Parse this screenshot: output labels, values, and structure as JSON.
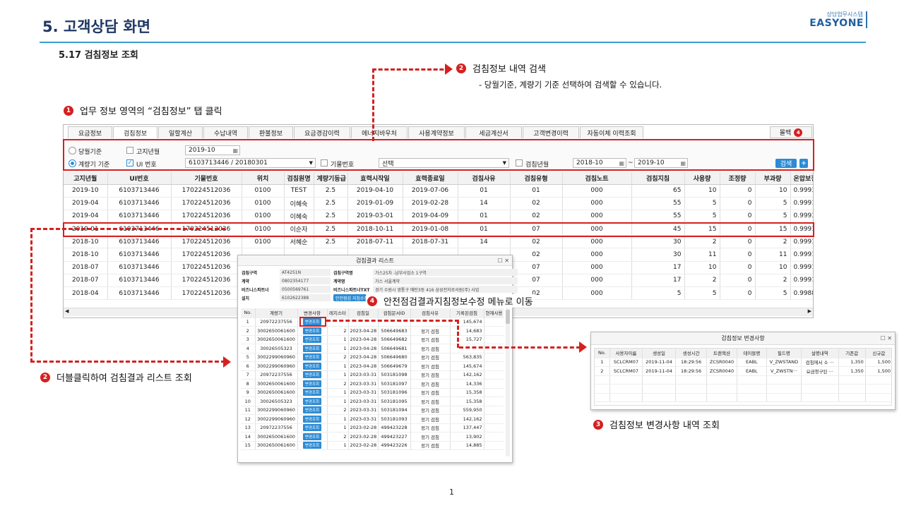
{
  "header": {
    "title": "5. 고객상담 화면",
    "brand_sub": "상담업무시스템",
    "brand": "EASYONE",
    "section": "5.17 검침정보 조회"
  },
  "annotations": {
    "a1": {
      "num": "1",
      "text": "업무 정보 영역의 “검침정보” 탭 클릭"
    },
    "a2": {
      "num": "2",
      "text": "검침정보 내역 검색",
      "sub": "-   당월기준, 계량기 기준 선택하여 검색할 수 있습니다."
    },
    "a2b": {
      "num": "2",
      "text": "더블클릭하여 검침결과 리스트 조회"
    },
    "a3": {
      "num": "3",
      "text": "검침정보 변경사항 내역 조회"
    },
    "a4": {
      "num": "4",
      "text": "안전점검결과지침정보수정 메뉴로 이동"
    }
  },
  "tabs": [
    "요금정보",
    "검침정보",
    "일할계산",
    "수납내역",
    "환불정보",
    "요금경감이력",
    "에너지바우처",
    "사용계약정보",
    "세금계산서",
    "고객변경이력",
    "자동이체 이력조회"
  ],
  "all_tab": {
    "label": "몰백",
    "badge": "4"
  },
  "search": {
    "radio1": "당월기준",
    "notice_month_label": "고지년월",
    "notice_month_value": "2019-10",
    "radio2": "계량기 기준",
    "ui_label": "UI 번호",
    "ui_value": "6103713446 / 20180301",
    "meter_label": "기물번호",
    "meter_select": "선택",
    "read_month_label": "검침년월",
    "from": "2018-10",
    "tilde": "~",
    "to": "2019-10",
    "search_btn": "검색",
    "plus": "+"
  },
  "main_table": {
    "headers": [
      "고지년월",
      "UI번호",
      "기물번호",
      "위치",
      "검침원명",
      "계량기등급",
      "효력시작일",
      "효력종료일",
      "검침사유",
      "검침유형",
      "검침노트",
      "검침지침",
      "사용량",
      "조정량",
      "부과량",
      "온압보정계수"
    ],
    "rows": [
      [
        "2019-10",
        "6103713446",
        "170224512036",
        "0100",
        "TEST",
        "2.5",
        "2019-04-10",
        "2019-07-06",
        "01",
        "01",
        "000",
        "65",
        "10",
        "0",
        "10",
        "0.9993"
      ],
      [
        "2019-04",
        "6103713446",
        "170224512036",
        "0100",
        "이혜숙",
        "2.5",
        "2019-01-09",
        "2019-02-28",
        "14",
        "02",
        "000",
        "55",
        "5",
        "0",
        "5",
        "0.9991"
      ],
      [
        "2019-04",
        "6103713446",
        "170224512036",
        "0100",
        "이혜숙",
        "2.5",
        "2019-03-01",
        "2019-04-09",
        "01",
        "02",
        "000",
        "55",
        "5",
        "0",
        "5",
        "0.9993"
      ],
      [
        "2019-01",
        "6103713446",
        "170224512036",
        "0100",
        "이순자",
        "2.5",
        "2018-10-11",
        "2019-01-08",
        "01",
        "07",
        "000",
        "45",
        "15",
        "0",
        "15",
        "0.9991"
      ],
      [
        "2018-10",
        "6103713446",
        "170224512036",
        "0100",
        "서혜순",
        "2.5",
        "2018-07-11",
        "2018-07-31",
        "14",
        "02",
        "000",
        "30",
        "2",
        "0",
        "2",
        "0.9991"
      ],
      [
        "2018-10",
        "6103713446",
        "170224512036",
        "",
        "",
        "",
        "",
        "",
        "",
        "02",
        "000",
        "30",
        "11",
        "0",
        "11",
        "0.9991"
      ],
      [
        "2018-07",
        "6103713446",
        "170224512036",
        "",
        "",
        "",
        "",
        "",
        "",
        "07",
        "000",
        "17",
        "10",
        "0",
        "10",
        "0.9991"
      ],
      [
        "2018-07",
        "6103713446",
        "170224512036",
        "",
        "",
        "",
        "",
        "",
        "",
        "07",
        "000",
        "17",
        "2",
        "0",
        "2",
        "0.9991"
      ],
      [
        "2018-04",
        "6103713446",
        "170224512036",
        "",
        "",
        "",
        "",
        "",
        "",
        "02",
        "000",
        "5",
        "5",
        "0",
        "5",
        "0.9988"
      ]
    ]
  },
  "result_popup": {
    "title": "검침결과 리스트",
    "info": [
      [
        "검침구역",
        "AT4251N",
        "검침구역명",
        "가스25차 -남부사업소 1구역"
      ],
      [
        "계약",
        "0802354177",
        "계약명",
        "가스 서울계약"
      ],
      [
        "비즈니스파트너",
        "0500569761",
        "비즈니스파트너TXT",
        "경기 수원시 영통구 매탄3동 416 삼성전자로서원(주) 사업"
      ],
      [
        "설치",
        "6102622388",
        "",
        ""
      ]
    ],
    "nav_btn": "안전점검 지침수정",
    "headers": [
      "No.",
      "계량기",
      "변경사항",
      "레지스터",
      "검침일",
      "검침문서ID",
      "검침사유",
      "기록된검침",
      "현재사용"
    ],
    "rows": [
      [
        "1",
        "20972237556",
        "변경조회",
        "",
        "",
        "",
        "",
        "145,674",
        ""
      ],
      [
        "2",
        "3002650061600",
        "변경조회",
        "2",
        "2023-04-28",
        "506649683",
        "정기 검침",
        "14,683",
        ""
      ],
      [
        "3",
        "3002650061600",
        "변경조회",
        "1",
        "2023-04-28",
        "506649682",
        "정기 검침",
        "15,727",
        ""
      ],
      [
        "4",
        "30026505323",
        "변경조회",
        "1",
        "2023-04-28",
        "506649681",
        "정기 검침",
        "",
        ""
      ],
      [
        "5",
        "3002299060960",
        "변경조회",
        "2",
        "2023-04-28",
        "506649680",
        "정기 검침",
        "563,835",
        ""
      ],
      [
        "6",
        "3002299060960",
        "변경조회",
        "1",
        "2023-04-28",
        "506649679",
        "정기 검침",
        "145,674",
        ""
      ],
      [
        "7",
        "20972237556",
        "변경조회",
        "1",
        "2023-03-31",
        "503181098",
        "정기 검침",
        "142,162",
        ""
      ],
      [
        "8",
        "3002650061600",
        "변경조회",
        "2",
        "2023-03-31",
        "503181097",
        "정기 검침",
        "14,336",
        ""
      ],
      [
        "9",
        "3002650061600",
        "변경조회",
        "1",
        "2023-03-31",
        "503181096",
        "정기 검침",
        "15,358",
        ""
      ],
      [
        "10",
        "30026505323",
        "변경조회",
        "1",
        "2023-03-31",
        "503181095",
        "정기 검침",
        "15,358",
        ""
      ],
      [
        "11",
        "3002299060960",
        "변경조회",
        "2",
        "2023-03-31",
        "503181094",
        "정기 검침",
        "559,950",
        ""
      ],
      [
        "12",
        "3002299060960",
        "변경조회",
        "1",
        "2023-03-31",
        "503181093",
        "정기 검침",
        "142,162",
        ""
      ],
      [
        "13",
        "20972237556",
        "변경조회",
        "1",
        "2023-02-28",
        "499423228",
        "정기 검침",
        "137,447",
        ""
      ],
      [
        "14",
        "3002650061600",
        "변경조회",
        "2",
        "2023-02-28",
        "499423227",
        "정기 검침",
        "13,902",
        ""
      ],
      [
        "15",
        "3002650061600",
        "변경조회",
        "1",
        "2023-02-28",
        "499423226",
        "정기 검침",
        "14,885",
        ""
      ]
    ]
  },
  "change_popup": {
    "title": "검침정보 변경사항",
    "headers": [
      "No.",
      "사용자이름",
      "생성일",
      "생성시간",
      "트랜잭션",
      "테이블명",
      "필드명",
      "설명내역",
      "기존값",
      "신규값"
    ],
    "rows": [
      [
        "1",
        "SCLCRM07",
        "2019-11-04",
        "18:29:56",
        "ZCSR0040",
        "EABL",
        "V_ZWSTAND",
        "검침에서 소 ···",
        "1,350",
        "1,500"
      ],
      [
        "2",
        "SCLCRM07",
        "2019-11-04",
        "18:29:56",
        "ZCSR0040",
        "EABL",
        "V_ZWSTN···",
        "요금청구된 ···",
        "1,350",
        "1,500"
      ]
    ]
  },
  "page_number": "1",
  "colors": {
    "accent": "#d52020",
    "brand": "#1f5fa0",
    "button": "#2d8bd3"
  }
}
